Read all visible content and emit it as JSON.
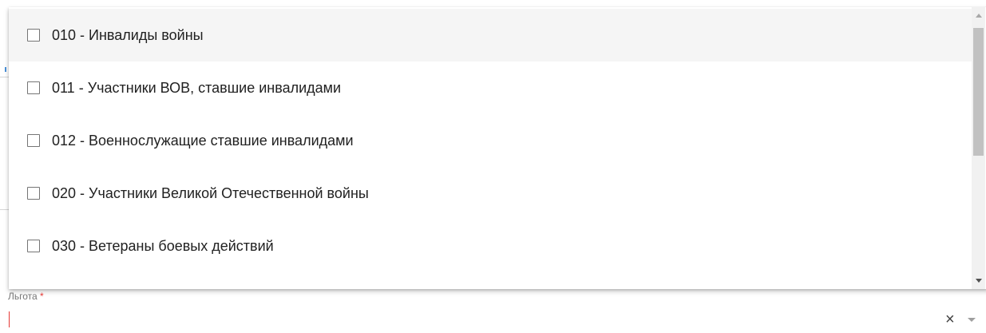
{
  "options": [
    {
      "label": "010 - Инвалиды войны",
      "checked": false,
      "highlighted": true
    },
    {
      "label": "011 - Участники ВОВ, ставшие инвалидами",
      "checked": false,
      "highlighted": false
    },
    {
      "label": "012 - Военнослужащие ставшие инвалидами",
      "checked": false,
      "highlighted": false
    },
    {
      "label": "020 - Участники Великой Отечественной войны",
      "checked": false,
      "highlighted": false
    },
    {
      "label": "030 - Ветераны боевых действий",
      "checked": false,
      "highlighted": false
    }
  ],
  "field": {
    "label": "Льгота",
    "required_mark": "*",
    "value": "",
    "clear_icon": "×"
  },
  "colors": {
    "required": "#e53935",
    "hover_bg": "#f5f5f5"
  }
}
